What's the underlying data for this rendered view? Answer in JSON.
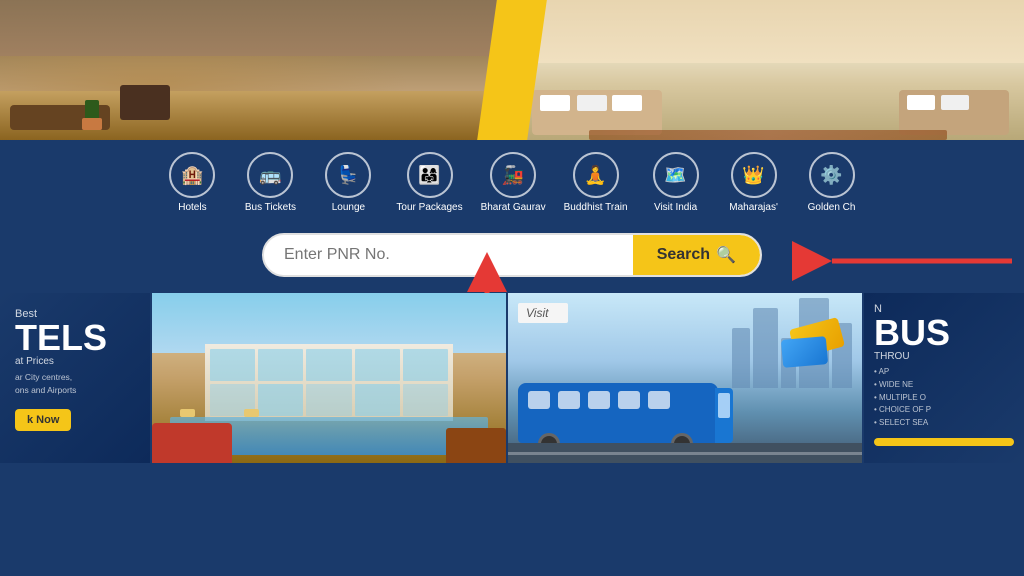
{
  "hero": {
    "left_alt": "Hotel room left",
    "right_alt": "Hotel room right"
  },
  "nav": {
    "items": [
      {
        "id": "hotels",
        "label": "Hotels",
        "icon": "🏨"
      },
      {
        "id": "bus-tickets",
        "label": "Bus Tickets",
        "icon": "🚌"
      },
      {
        "id": "lounge",
        "label": "Lounge",
        "icon": "💺"
      },
      {
        "id": "tour-packages",
        "label": "Tour Packages",
        "icon": "👨‍👩‍👧"
      },
      {
        "id": "bharat-gaurav",
        "label": "Bharat Gaurav",
        "icon": "🚂"
      },
      {
        "id": "buddhist-train",
        "label": "Buddhist Train",
        "icon": "🧘"
      },
      {
        "id": "visit-india",
        "label": "Visit India",
        "icon": "🗺️"
      },
      {
        "id": "maharajas",
        "label": "Maharajas'",
        "icon": "👑"
      },
      {
        "id": "golden-ch",
        "label": "Golden Ch",
        "icon": "⚙️"
      }
    ]
  },
  "search": {
    "placeholder": "Enter PNR No.",
    "button_label": "Search",
    "search_icon": "🔍"
  },
  "banners": {
    "hotels": {
      "title": "TELS",
      "prefix": "Best",
      "subtitle": "at Prices",
      "desc": "ar City centres,\nons and Airports",
      "cta": "k Now"
    },
    "visit": {
      "label": "Visit"
    },
    "bus": {
      "title": "BUS",
      "prefix": "N",
      "subtitle": "THROU",
      "desc": "• AP\n• WIDE NE\n• MULTIPLE O\n• CHOICE OF P\n• SELECT SEA"
    }
  },
  "arrows": {
    "left_arrow_label": "arrow pointing to search input",
    "right_arrow_label": "arrow pointing to search button"
  }
}
